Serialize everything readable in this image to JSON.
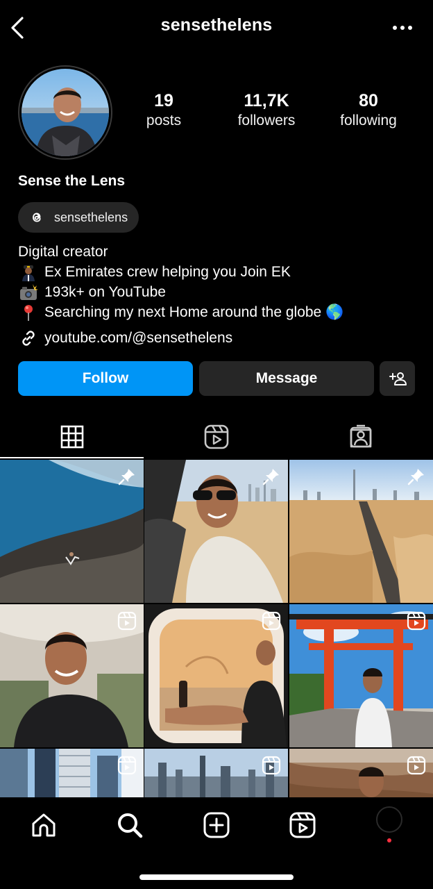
{
  "header": {
    "username": "sensethelens",
    "back_icon": "chevron-left-icon",
    "more_icon": "more-horizontal-icon"
  },
  "profile": {
    "display_name": "Sense the Lens",
    "stats": [
      {
        "value": "19",
        "label": "posts"
      },
      {
        "value": "11,7K",
        "label": "followers"
      },
      {
        "value": "80",
        "label": "following"
      }
    ],
    "threads_handle": "sensethelens",
    "bio": {
      "category": "Digital creator",
      "lines": [
        {
          "emoji": "pilot-emoji",
          "text": "Ex Emirates crew helping you Join EK"
        },
        {
          "emoji": "camera-flash-emoji",
          "text": "193k+ on YouTube"
        },
        {
          "emoji": "round-pushpin-emoji",
          "text": "Searching my next Home around the globe 🌎"
        }
      ]
    },
    "link": "youtube.com/@sensethelens"
  },
  "actions": {
    "follow_label": "Follow",
    "message_label": "Message",
    "follow_color": "#0095f6",
    "secondary_color": "#262626"
  },
  "tabs": [
    {
      "icon": "grid-icon",
      "active": true
    },
    {
      "icon": "reels-icon",
      "active": false
    },
    {
      "icon": "tagged-icon",
      "active": false
    }
  ],
  "grid_posts": [
    {
      "type": "pinned",
      "scene": "coastal cliff"
    },
    {
      "type": "pinned",
      "scene": "desert selfie"
    },
    {
      "type": "pinned",
      "scene": "desert road"
    },
    {
      "type": "reel",
      "scene": "airplane cabin selfie"
    },
    {
      "type": "reel",
      "scene": "window seat"
    },
    {
      "type": "reel",
      "scene": "torii gate"
    },
    {
      "type": "reel",
      "scene": "skyscrapers"
    },
    {
      "type": "reel",
      "scene": "city skyline"
    },
    {
      "type": "reel",
      "scene": "canyon"
    }
  ],
  "bottom_nav": [
    "home-icon",
    "search-icon",
    "create-icon",
    "reels-icon",
    "profile-avatar"
  ]
}
